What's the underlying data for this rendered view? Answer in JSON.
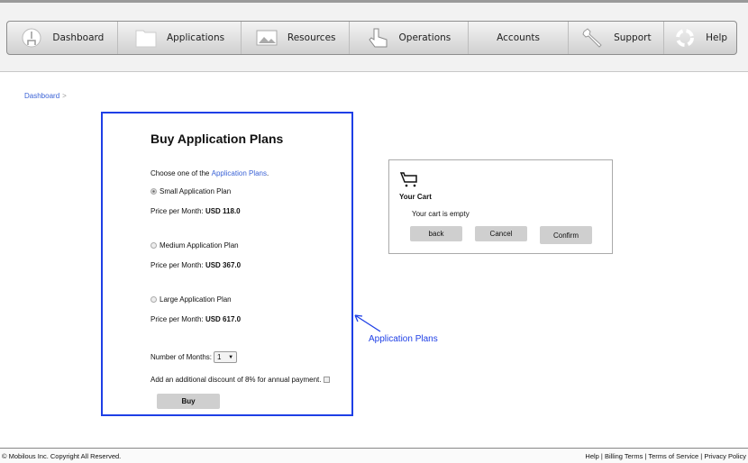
{
  "nav": {
    "items": [
      {
        "label": "Dashboard",
        "icon": "gauge-icon"
      },
      {
        "label": "Applications",
        "icon": "folder-icon"
      },
      {
        "label": "Resources",
        "icon": "image-icon"
      },
      {
        "label": "Operations",
        "icon": "hand-pointer-icon"
      },
      {
        "label": "Accounts",
        "icon": ""
      },
      {
        "label": "Support",
        "icon": "wrench-icon"
      },
      {
        "label": "Help",
        "icon": "lifebuoy-icon"
      }
    ]
  },
  "breadcrumb": {
    "items": [
      "Dashboard"
    ]
  },
  "plans": {
    "title": "Buy Application Plans",
    "intro_prefix": "Choose one of the ",
    "intro_link": "Application Plans",
    "intro_suffix": ".",
    "price_label": "Price per Month: ",
    "options": [
      {
        "label": "Small Application Plan",
        "price": "USD 118.0",
        "selected": true
      },
      {
        "label": "Medium Application Plan",
        "price": "USD 367.0",
        "selected": false
      },
      {
        "label": "Large Application Plan",
        "price": "USD 617.0",
        "selected": false
      }
    ],
    "months_label": "Number of Months:",
    "months_value": "1",
    "discount_label": "Add an additional discount of 8% for annual payment.",
    "discount_checked": false,
    "buy_label": "Buy"
  },
  "cart": {
    "title": "Your Cart",
    "empty_text": "Your cart is empty",
    "back_label": "back",
    "cancel_label": "Cancel",
    "confirm_label": "Confirm"
  },
  "annotation": {
    "label": "Application Plans",
    "color": "#1e3fe6"
  },
  "footer": {
    "copyright": "© Mobilous Inc. Copyright All Reserved.",
    "links": [
      "Help",
      "Billing Terms",
      "Terms of Service",
      "Privacy Policy"
    ]
  }
}
